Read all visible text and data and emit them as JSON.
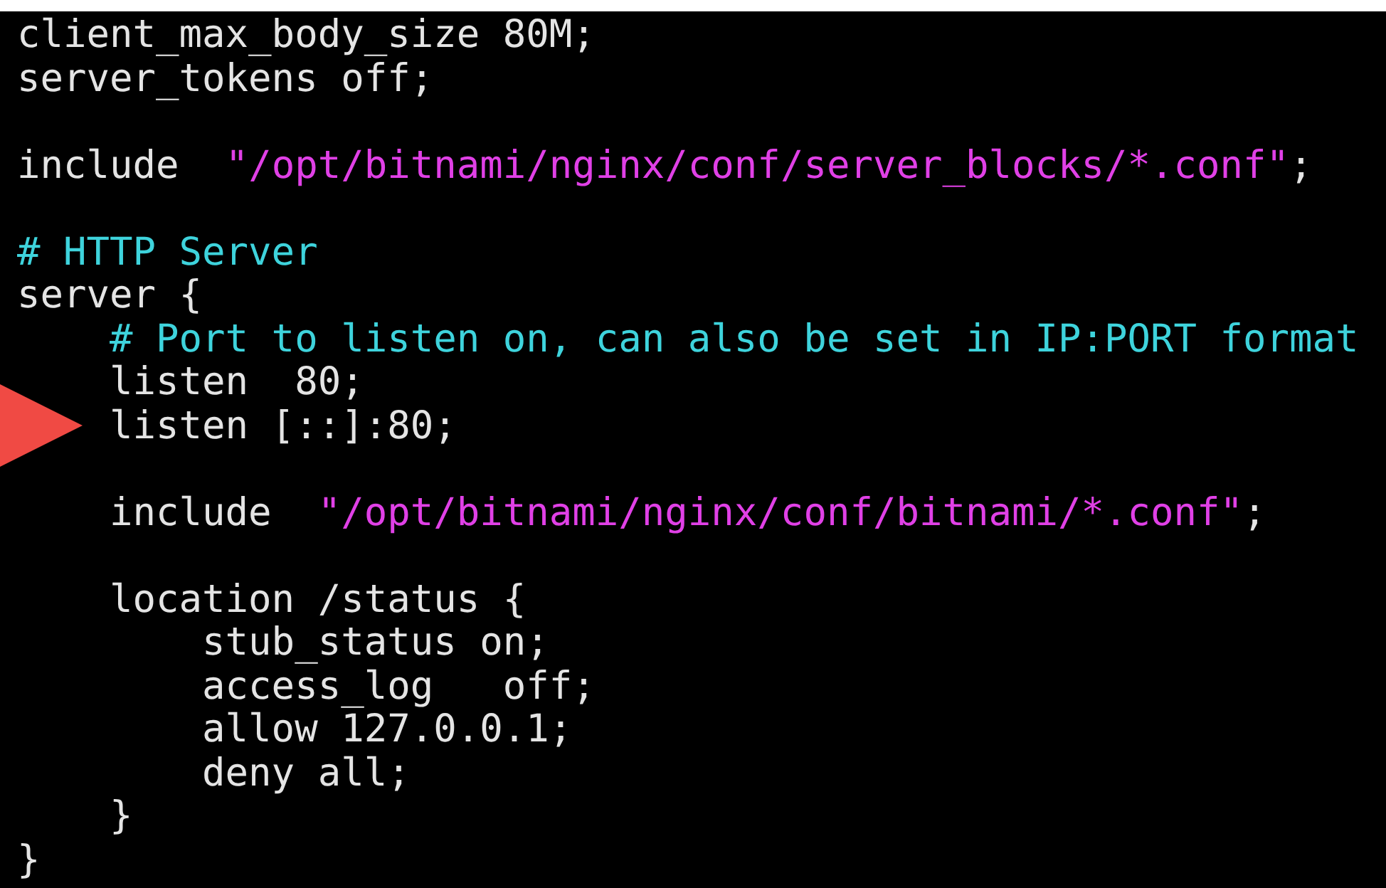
{
  "terminal": {
    "lines": [
      {
        "kind": "code",
        "segments": [
          {
            "kind": "plain",
            "text": "client_max_body_size 80M;"
          }
        ]
      },
      {
        "kind": "code",
        "segments": [
          {
            "kind": "plain",
            "text": "server_tokens off;"
          }
        ]
      },
      {
        "kind": "blank"
      },
      {
        "kind": "code",
        "segments": [
          {
            "kind": "plain",
            "text": "include  "
          },
          {
            "kind": "string",
            "text": "\"/opt/bitnami/nginx/conf/server_blocks/*.conf\""
          },
          {
            "kind": "plain",
            "text": ";"
          }
        ]
      },
      {
        "kind": "blank"
      },
      {
        "kind": "code",
        "segments": [
          {
            "kind": "comment",
            "text": "# HTTP Server"
          }
        ]
      },
      {
        "kind": "code",
        "segments": [
          {
            "kind": "plain",
            "text": "server {"
          }
        ]
      },
      {
        "kind": "code",
        "segments": [
          {
            "kind": "comment",
            "text": "    # Port to listen on, can also be set in IP:PORT format"
          }
        ]
      },
      {
        "kind": "code",
        "segments": [
          {
            "kind": "plain",
            "text": "    listen  80;"
          }
        ]
      },
      {
        "kind": "code",
        "segments": [
          {
            "kind": "plain",
            "text": "    listen [::]:80;"
          }
        ]
      },
      {
        "kind": "blank"
      },
      {
        "kind": "code",
        "segments": [
          {
            "kind": "plain",
            "text": "    include  "
          },
          {
            "kind": "string",
            "text": "\"/opt/bitnami/nginx/conf/bitnami/*.conf\""
          },
          {
            "kind": "plain",
            "text": ";"
          }
        ]
      },
      {
        "kind": "blank"
      },
      {
        "kind": "code",
        "segments": [
          {
            "kind": "plain",
            "text": "    location /status {"
          }
        ]
      },
      {
        "kind": "code",
        "segments": [
          {
            "kind": "plain",
            "text": "        stub_status on;"
          }
        ]
      },
      {
        "kind": "code",
        "segments": [
          {
            "kind": "plain",
            "text": "        access_log   off;"
          }
        ]
      },
      {
        "kind": "code",
        "segments": [
          {
            "kind": "plain",
            "text": "        allow 127.0.0.1;"
          }
        ]
      },
      {
        "kind": "code",
        "segments": [
          {
            "kind": "plain",
            "text": "        deny all;"
          }
        ]
      },
      {
        "kind": "code",
        "segments": [
          {
            "kind": "plain",
            "text": "    }"
          }
        ]
      },
      {
        "kind": "code",
        "segments": [
          {
            "kind": "plain",
            "text": "}"
          }
        ]
      }
    ]
  }
}
